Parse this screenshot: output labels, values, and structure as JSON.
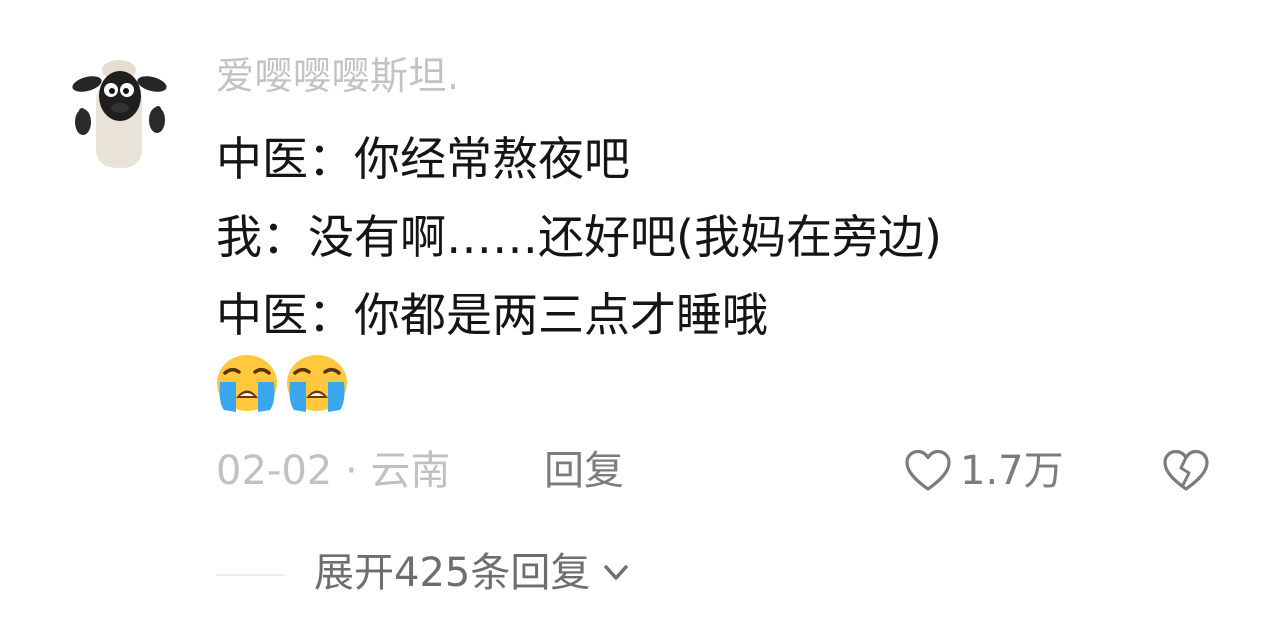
{
  "comment": {
    "username": "爱嘤嘤嘤斯坦.",
    "lines": [
      "中医：你经常熬夜吧",
      "我：没有啊……还好吧(我妈在旁边)",
      "中医：你都是两三点才睡哦"
    ],
    "emojis": [
      "loudly-crying-face-emoji",
      "loudly-crying-face-emoji"
    ],
    "date_location": "02-02 · 云南",
    "reply_label": "回复",
    "like_count": "1.7万",
    "expand_label": "展开425条回复"
  },
  "icons": {
    "like": "heart-icon",
    "dislike": "broken-heart-icon",
    "expand": "chevron-down-icon"
  },
  "colors": {
    "username": "#c3c3c3",
    "text": "#151515",
    "meta": "#c1c1c1",
    "action": "#7c7c7c"
  }
}
